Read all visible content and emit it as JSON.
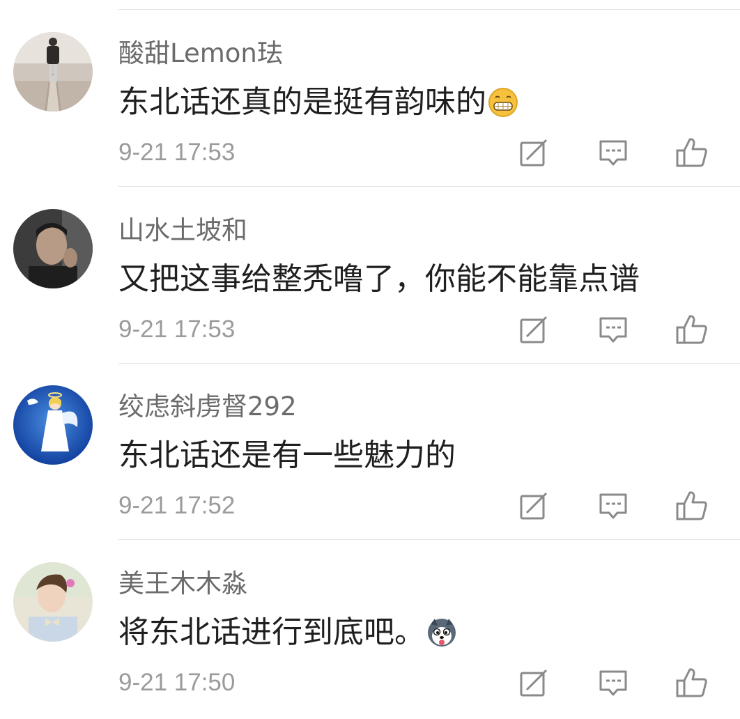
{
  "comments": [
    {
      "username": "酸甜Lemon珐",
      "text": "东北话还真的是挺有韵味的",
      "emoji": "grin-emoji",
      "timestamp": "9-21 17:53",
      "avatar": "avatar-person-walking-path"
    },
    {
      "username": "山水土坡和",
      "text": "又把这事给整秃噜了，你能不能靠点谱",
      "emoji": "",
      "timestamp": "9-21 17:53",
      "avatar": "avatar-man-portrait-dark"
    },
    {
      "username": "绞虑斜虏督292",
      "text": "东北话还是有一些魅力的",
      "emoji": "",
      "timestamp": "9-21 17:52",
      "avatar": "avatar-angel-blue"
    },
    {
      "username": "美王木木淼",
      "text": "将东北话进行到底吧。",
      "emoji": "husky-emoji",
      "timestamp": "9-21 17:50",
      "avatar": "avatar-young-man-bowtie"
    }
  ],
  "actions": {
    "edit_icon": "edit-icon",
    "reply_icon": "reply-comment-icon",
    "like_icon": "thumbs-up-icon"
  },
  "colors": {
    "username": "#6b6b6b",
    "text": "#1f1f1f",
    "timestamp": "#9b9b9b",
    "icon": "#8a8a8a",
    "divider": "#e3e3e3"
  }
}
